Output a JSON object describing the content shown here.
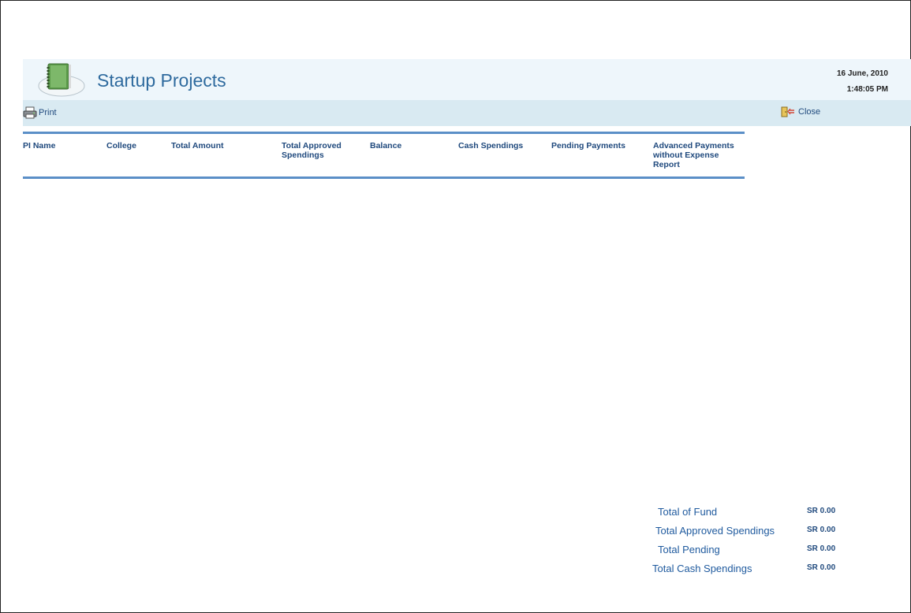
{
  "header": {
    "title": "Startup Projects",
    "date": "16 June, 2010",
    "time": "1:48:05 PM",
    "logo_icon": "notebook-icon"
  },
  "toolbar": {
    "print_label": "Print",
    "print_icon": "printer-icon",
    "close_label": "Close",
    "close_icon": "close-door-icon"
  },
  "table": {
    "columns": [
      "PI Name",
      "College",
      "Total Amount",
      "Total Approved Spendings",
      "Balance",
      "Cash Spendings",
      "Pending Payments",
      "Advanced Payments without Expense Report"
    ],
    "rows": []
  },
  "totals": [
    {
      "label": "Total of Fund",
      "value": "SR 0.00"
    },
    {
      "label": "Total Approved Spendings",
      "value": "SR 0.00"
    },
    {
      "label": "Total Pending",
      "value": "SR 0.00"
    },
    {
      "label": "Total Cash Spendings",
      "value": "SR 0.00"
    }
  ],
  "colors": {
    "header_bg": "#eef6fb",
    "toolbar_bg": "#d9eaf2",
    "rule": "#5b8fc7",
    "title": "#2e6a9e"
  }
}
